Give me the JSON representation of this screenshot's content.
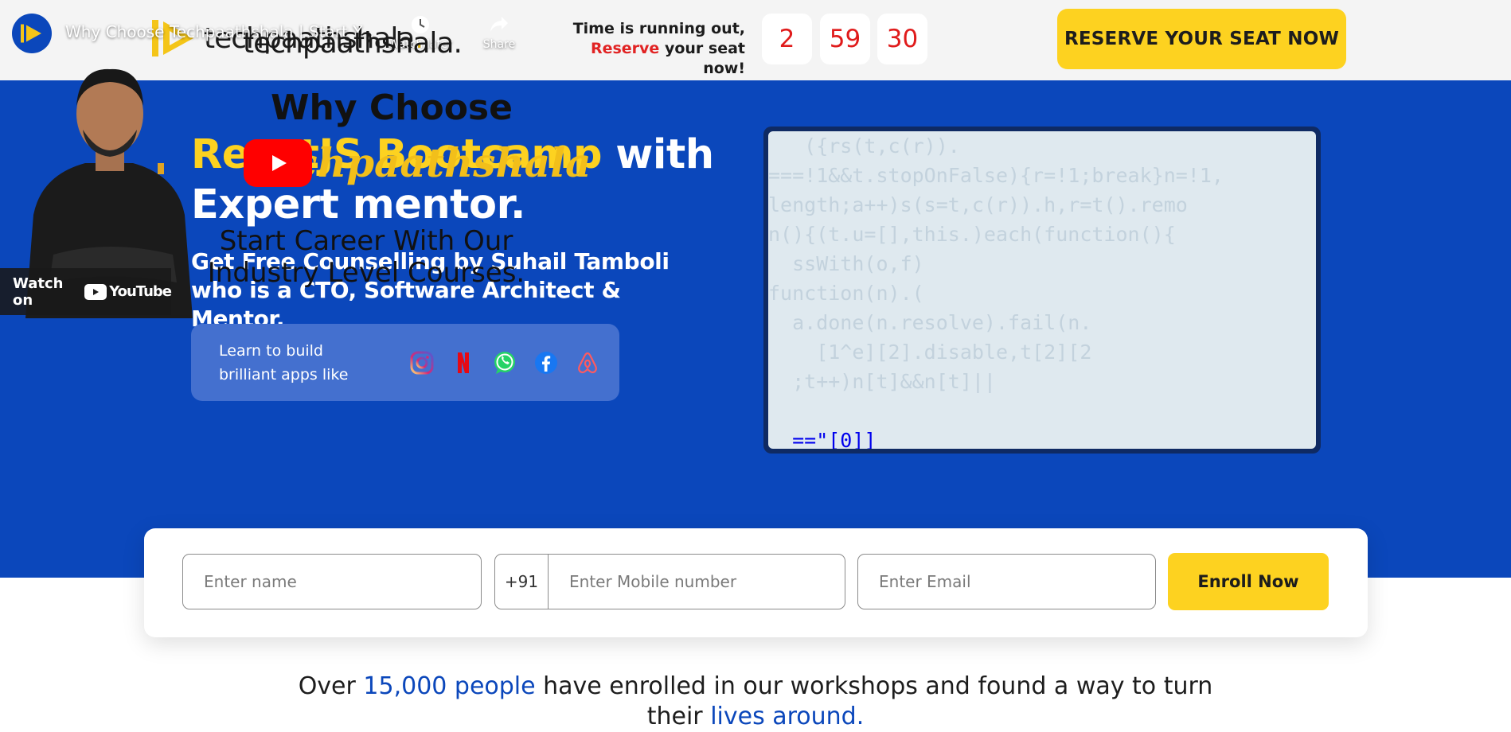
{
  "header": {
    "logo_text": "techpaathshala",
    "logo_dot": ".",
    "timer_line1": "Time is running out,",
    "timer_line2_highlight": "Reserve",
    "timer_line2_rest": " your seat now!",
    "timer": [
      "2",
      "59",
      "30"
    ],
    "reserve_button": "RESERVE YOUR SEAT NOW"
  },
  "hero": {
    "headline_highlight": "ReactJS Bootcamp",
    "headline_rest": " with Expert mentor.",
    "subhead": "Get Free Counselling by Suhail Tamboli who is a CTO, Software Architect & Mentor.",
    "apps_label": "Learn to build brilliant apps like",
    "app_icons": [
      "instagram-icon",
      "netflix-icon",
      "whatsapp-icon",
      "facebook-icon",
      "airbnb-icon"
    ]
  },
  "video": {
    "title": "Why Choose Techpaathshala | Start Y...",
    "watch_later": "Watch later",
    "share": "Share",
    "brand_text": "techpaathshala.",
    "why_choose": "Why Choose",
    "script_text": "Techpaathshala",
    "career_text": "Start Career With Our Industry Level Courses.",
    "watch_on": "Watch on",
    "youtube": "YouTube"
  },
  "form": {
    "name_placeholder": "Enter name",
    "country_code": "+91",
    "mobile_placeholder": "Enter Mobile number",
    "email_placeholder": "Enter Email",
    "enroll_button": "Enroll Now"
  },
  "statement": {
    "prefix": "Over ",
    "highlight": "15,000 people",
    "middle": " have enrolled in our workshops and found a way to turn their ",
    "highlight2": "lives around."
  },
  "colors": {
    "brand_blue": "#0b47bb",
    "accent_yellow": "#fdd220",
    "timer_red": "#e01b1b"
  }
}
